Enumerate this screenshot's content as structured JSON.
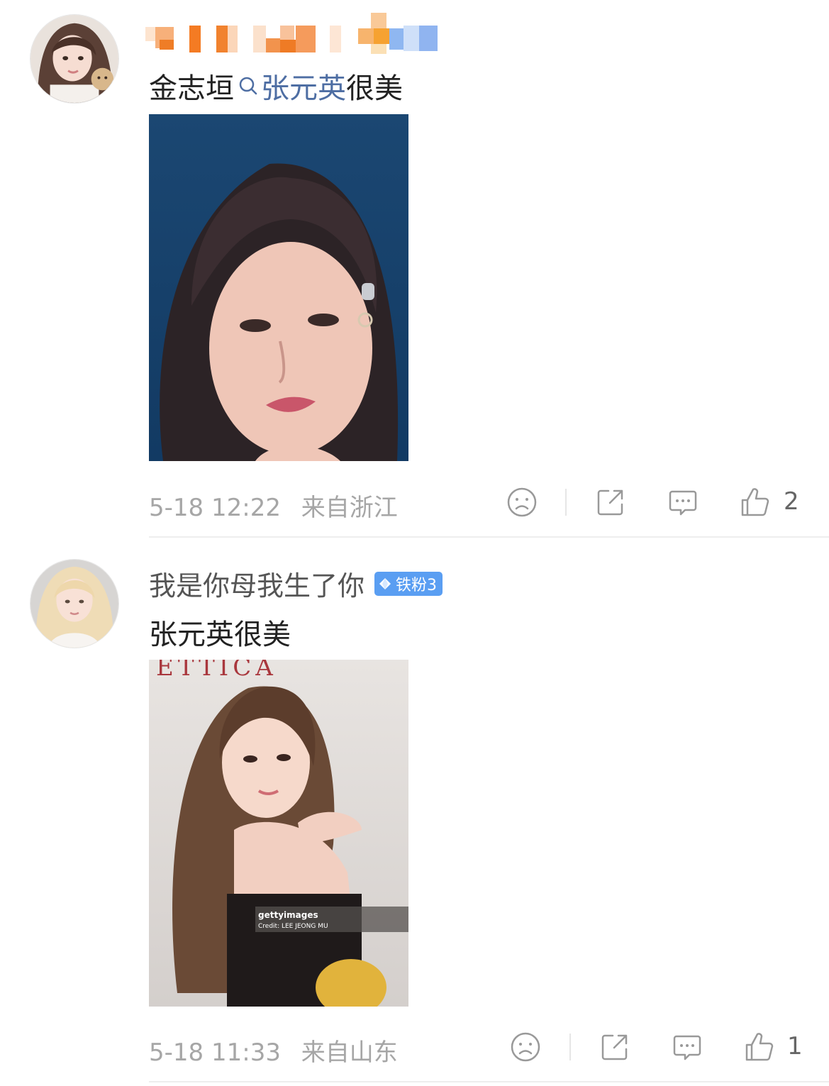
{
  "comments": [
    {
      "username": "",
      "text_prefix": "金志垣",
      "topic": "张元英",
      "text_suffix": "很美",
      "date": "5-18 12:22",
      "location": "来自浙江",
      "like_count": "2",
      "icons": [
        "dislike-icon",
        "share-icon",
        "comment-icon",
        "like-icon"
      ]
    },
    {
      "username": "我是你母我生了你",
      "badge": "铁粉3",
      "text": "张元英很美",
      "image_text": "ETTICA",
      "image_watermark": "gettyimages",
      "image_credit": "Credit: LEE JEONG MU",
      "date": "5-18 11:33",
      "location": "来自山东",
      "like_count": "1",
      "icons": [
        "dislike-icon",
        "share-icon",
        "comment-icon",
        "like-icon"
      ]
    }
  ],
  "colors": {
    "topic_link": "#4e6ea3",
    "badge": "#5a9ef2",
    "meta_text": "#a6a6a6",
    "icon": "#999999"
  }
}
